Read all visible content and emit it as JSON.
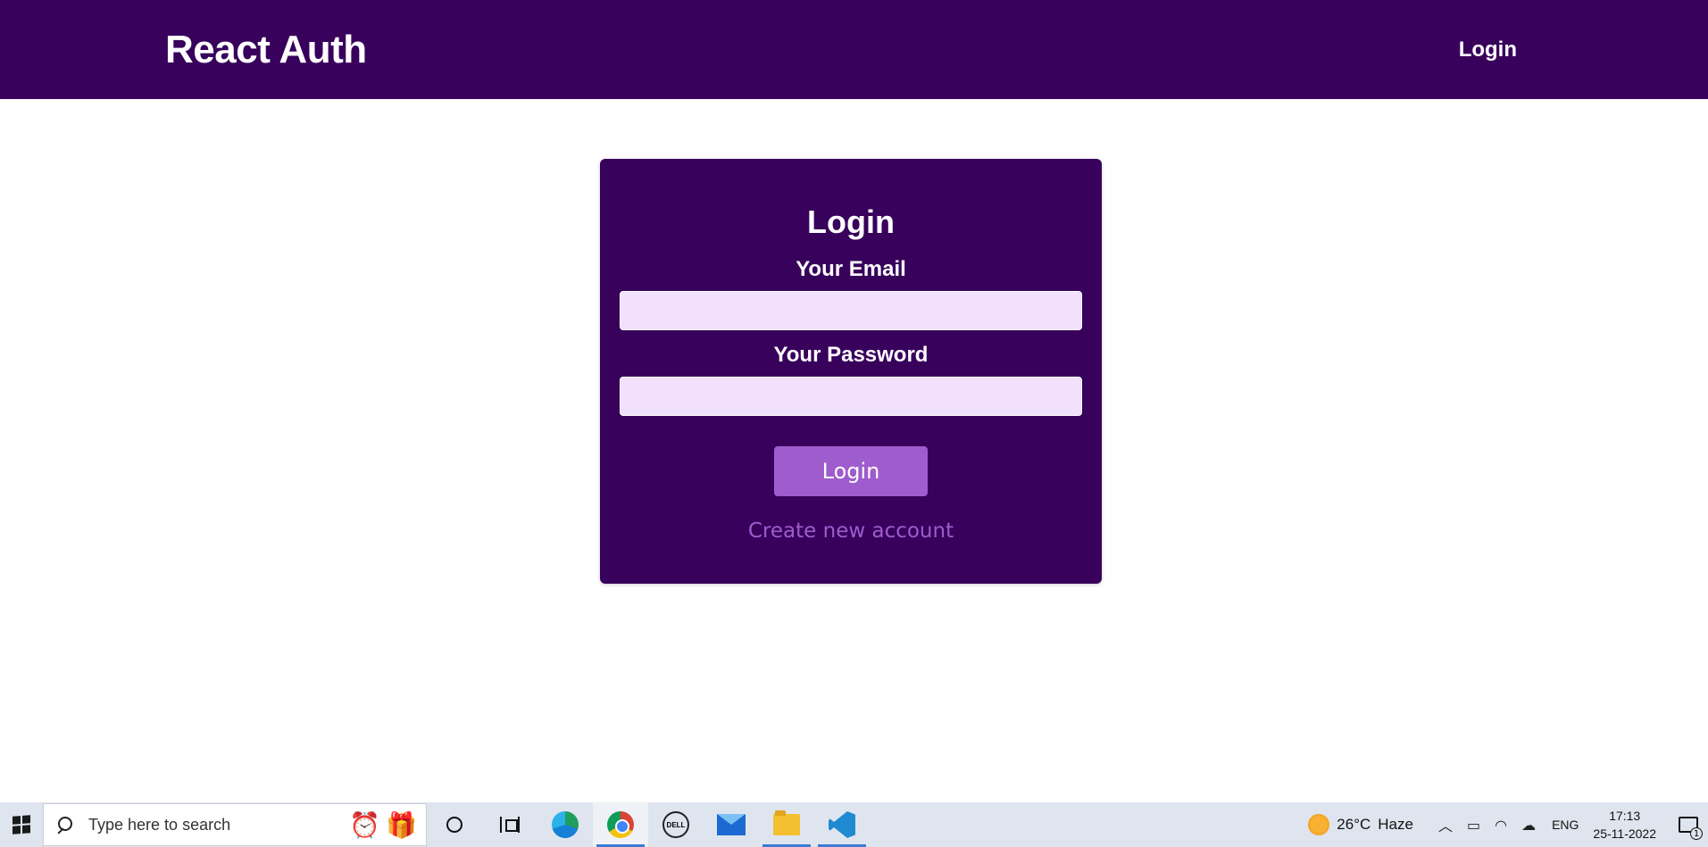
{
  "header": {
    "logo": "React Auth",
    "nav_login": "Login"
  },
  "auth_form": {
    "title": "Login",
    "email_label": "Your Email",
    "email_value": "",
    "password_label": "Your Password",
    "password_value": "",
    "submit_label": "Login",
    "toggle_label": "Create new account"
  },
  "taskbar": {
    "search_placeholder": "Type here to search",
    "weather": {
      "temperature": "26°C",
      "condition": "Haze"
    },
    "language": "ENG",
    "time": "17:13",
    "date": "25-11-2022",
    "notification_count": "1",
    "pinned_apps": [
      "cortana-icon",
      "task-view-icon",
      "edge-icon",
      "chrome-icon",
      "dell-icon",
      "mail-icon",
      "file-explorer-icon",
      "vscode-icon"
    ]
  },
  "colors": {
    "primary": "#38015c",
    "accent": "#9f5ccc",
    "input_bg": "#f1e1fc"
  }
}
